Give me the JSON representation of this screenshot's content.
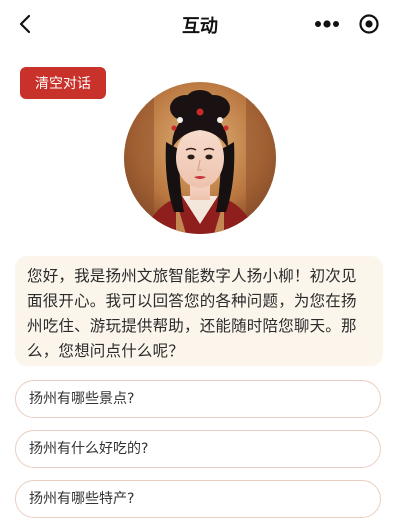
{
  "header": {
    "title": "互动",
    "back_icon": "chevron-left-icon",
    "more_icon": "more-dots-icon",
    "close_icon": "target-circle-icon"
  },
  "actions": {
    "clear_label": "清空对话",
    "clear_color": "#c9312b"
  },
  "chat": {
    "greeting": "您好，我是扬州文旅智能数字人扬小柳！初次见面很开心。我可以回答您的各种问题，为您在扬州吃住、游玩提供帮助，还能随时陪您聊天。那么，您想问点什么呢？"
  },
  "questions": [
    {
      "label": "扬州有哪些景点?"
    },
    {
      "label": "扬州有什么好吃的?"
    },
    {
      "label": "扬州有哪些特产?"
    }
  ]
}
